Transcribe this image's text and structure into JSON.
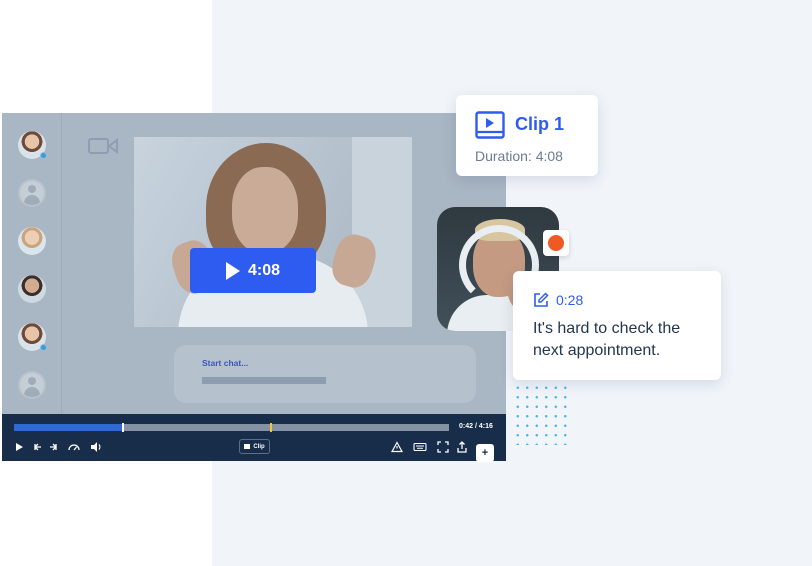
{
  "video_player": {
    "play_overlay_time": "4:08",
    "chat_placeholder": "Start chat...",
    "time_display": "0:42 / 4:16",
    "progress_fraction": 0.25,
    "clip_marker_fraction": 0.59,
    "clip_button_label": "Clip",
    "add_button_label": "+",
    "sidebar_participants": [
      {
        "icon": "participant-avatar",
        "online": true
      },
      {
        "icon": "user-placeholder-icon",
        "online": false
      },
      {
        "icon": "participant-avatar",
        "online": false
      },
      {
        "icon": "participant-avatar",
        "online": false
      },
      {
        "icon": "participant-avatar",
        "online": true
      },
      {
        "icon": "user-placeholder-icon",
        "online": false
      }
    ],
    "controls": [
      "play-icon",
      "rewind-icon",
      "forward-icon",
      "speed-icon",
      "volume-icon",
      "alert-icon",
      "keyboard-icon",
      "fullscreen-icon",
      "share-icon"
    ]
  },
  "clip_card": {
    "title": "Clip 1",
    "duration": "Duration: 4:08"
  },
  "comment_card": {
    "timestamp": "0:28",
    "text": "It's hard to check the next appointment."
  },
  "colors": {
    "accent": "#2f5cf0",
    "record": "#ef5a24",
    "player_bar": "#172d49",
    "panel_background": "#f1f5fa"
  }
}
